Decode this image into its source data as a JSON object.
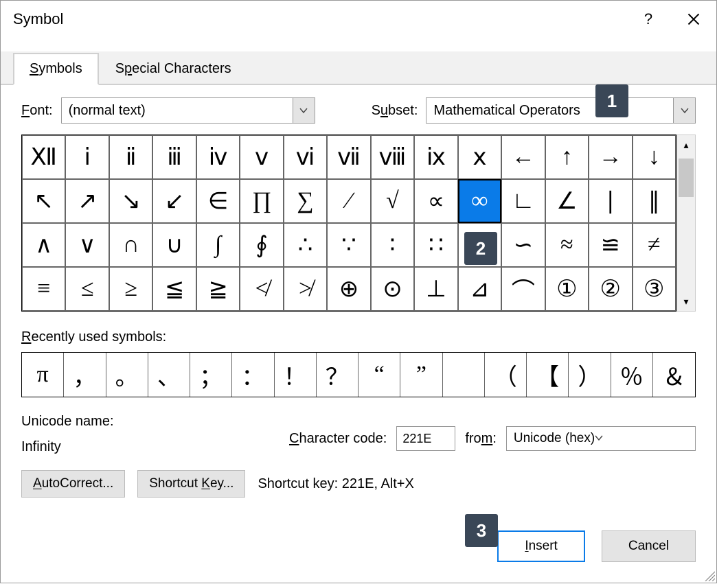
{
  "titlebar": {
    "title": "Symbol"
  },
  "tabs": {
    "symbols": "Symbols",
    "special": "Special Characters"
  },
  "font": {
    "label": "Font:",
    "value": "(normal text)"
  },
  "subset": {
    "label": "Subset:",
    "value": "Mathematical Operators"
  },
  "grid": [
    "Ⅻ",
    "ⅰ",
    "ⅱ",
    "ⅲ",
    "ⅳ",
    "ⅴ",
    "ⅵ",
    "ⅶ",
    "ⅷ",
    "ⅸ",
    "ⅹ",
    "←",
    "↑",
    "→",
    "↓",
    "↖",
    "↗",
    "↘",
    "↙",
    "∈",
    "∏",
    "∑",
    "∕",
    "√",
    "∝",
    "∞",
    "∟",
    "∠",
    "∣",
    "∥",
    "∧",
    "∨",
    "∩",
    "∪",
    "∫",
    "∮",
    "∴",
    "∵",
    "∶",
    "∷",
    "∼",
    "∽",
    "≈",
    "≌",
    "≠",
    "≡",
    "≤",
    "≥",
    "≦",
    "≧",
    "≮",
    "≯",
    "⊕",
    "⊙",
    "⊥",
    "⊿",
    "⌒",
    "①",
    "②",
    "③"
  ],
  "selectedIndex": 25,
  "recent": {
    "label": "Recently used symbols:",
    "items": [
      "π",
      "，",
      "。",
      "、",
      "；",
      "：",
      "！",
      "？",
      "“",
      "”",
      "",
      "（",
      "【",
      "）",
      "％",
      "＆"
    ]
  },
  "unicode": {
    "nameLabel": "Unicode name:",
    "nameValue": "Infinity"
  },
  "charcode": {
    "label": "Character code:",
    "value": "221E"
  },
  "from": {
    "label": "from:",
    "value": "Unicode (hex)"
  },
  "buttons": {
    "autocorrect": "AutoCorrect...",
    "shortcutKey": "Shortcut Key...",
    "shortcutText": "Shortcut key: 221E, Alt+X",
    "insert": "Insert",
    "cancel": "Cancel"
  },
  "markers": {
    "m1": "1",
    "m2": "2",
    "m3": "3"
  }
}
